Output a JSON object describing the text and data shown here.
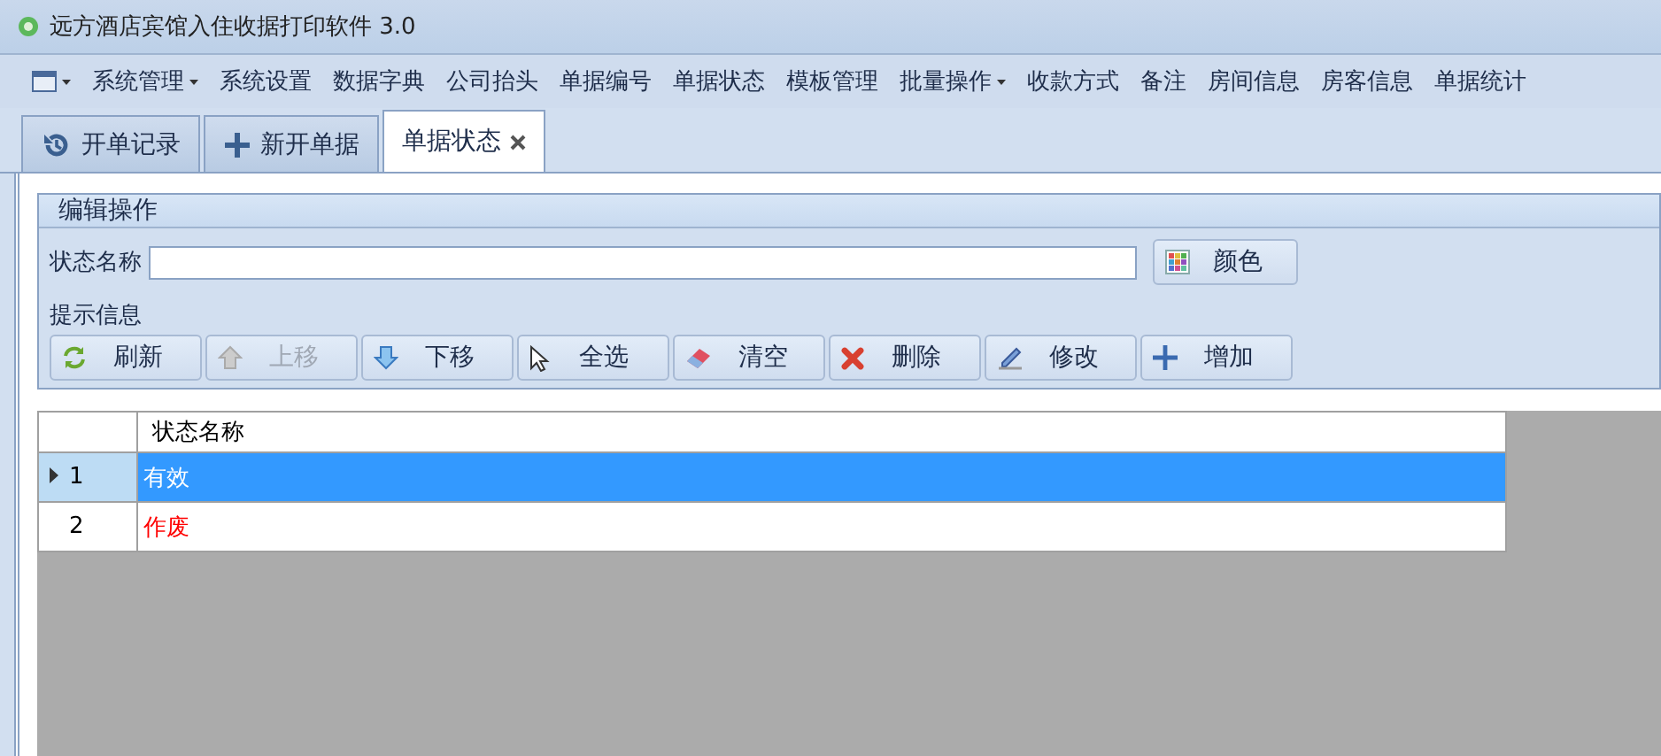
{
  "window": {
    "title": "远方酒店宾馆入住收据打印软件 3.0"
  },
  "menu": [
    {
      "dropdown": true
    },
    {
      "label": "系统管理",
      "dropdown": true
    },
    {
      "label": "系统设置",
      "dropdown": false
    },
    {
      "label": "数据字典",
      "dropdown": false
    },
    {
      "label": "公司抬头",
      "dropdown": false
    },
    {
      "label": "单据编号",
      "dropdown": false
    },
    {
      "label": "单据状态",
      "dropdown": false
    },
    {
      "label": "模板管理",
      "dropdown": false
    },
    {
      "label": "批量操作",
      "dropdown": true
    },
    {
      "label": "收款方式",
      "dropdown": false
    },
    {
      "label": "备注",
      "dropdown": false
    },
    {
      "label": "房间信息",
      "dropdown": false
    },
    {
      "label": "房客信息",
      "dropdown": false
    },
    {
      "label": "单据统计",
      "dropdown": false
    }
  ],
  "tabs": [
    {
      "label": "开单记录",
      "selected": false
    },
    {
      "label": "新开单据",
      "selected": false
    },
    {
      "label": "单据状态",
      "selected": true
    }
  ],
  "group": {
    "title": "编辑操作",
    "name_label": "状态名称",
    "color_button": "颜色",
    "hint_label": "提示信息"
  },
  "buttons": [
    {
      "label": "刷新",
      "disabled": false
    },
    {
      "label": "上移",
      "disabled": true
    },
    {
      "label": "下移",
      "disabled": false
    },
    {
      "label": "全选",
      "disabled": false
    },
    {
      "label": "清空",
      "disabled": false
    },
    {
      "label": "删除",
      "disabled": false
    },
    {
      "label": "修改",
      "disabled": false
    },
    {
      "label": "增加",
      "disabled": false
    }
  ],
  "table": {
    "columns": [
      "状态名称"
    ],
    "rows": [
      {
        "number": "1",
        "name": "有效",
        "selected": true
      },
      {
        "number": "2",
        "name": "作废",
        "selected": false,
        "color": "#ff0000"
      }
    ]
  }
}
